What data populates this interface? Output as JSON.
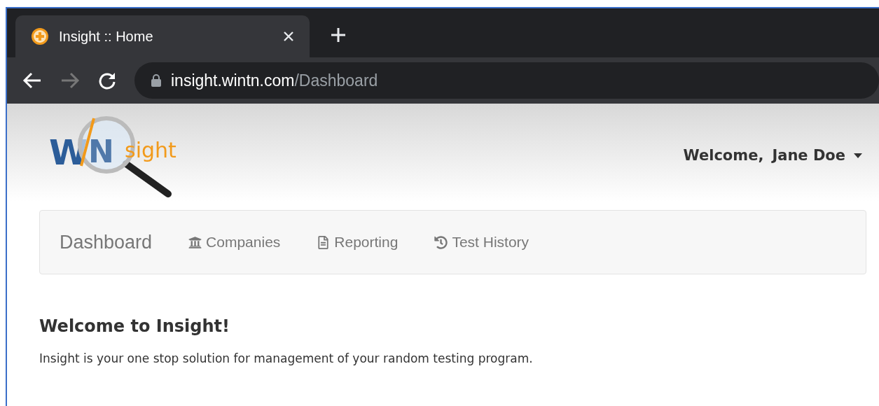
{
  "browser": {
    "tab": {
      "title": "Insight :: Home",
      "selected": true
    },
    "url": {
      "host": "insight.wintn.com",
      "path": "/Dashboard"
    }
  },
  "logo": {
    "lead": "W",
    "mid": "N",
    "tail": "sight"
  },
  "user_menu": {
    "greeting": "Welcome,",
    "name": "Jane Doe"
  },
  "nav": {
    "brand": "Dashboard",
    "items": [
      {
        "label": "Companies"
      },
      {
        "label": "Reporting"
      },
      {
        "label": "Test History"
      }
    ]
  },
  "content": {
    "heading": "Welcome to Insight!",
    "text": "Insight is your one stop solution for management of your random testing program."
  }
}
